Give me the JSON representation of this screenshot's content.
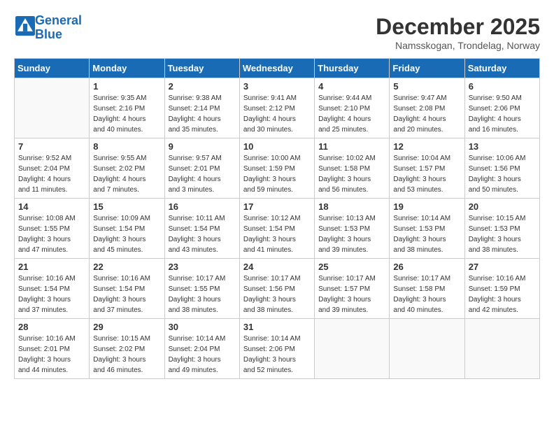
{
  "header": {
    "logo_line1": "General",
    "logo_line2": "Blue",
    "month": "December 2025",
    "location": "Namsskogan, Trondelag, Norway"
  },
  "days_of_week": [
    "Sunday",
    "Monday",
    "Tuesday",
    "Wednesday",
    "Thursday",
    "Friday",
    "Saturday"
  ],
  "weeks": [
    [
      {
        "day": "",
        "info": ""
      },
      {
        "day": "1",
        "info": "Sunrise: 9:35 AM\nSunset: 2:16 PM\nDaylight: 4 hours\nand 40 minutes."
      },
      {
        "day": "2",
        "info": "Sunrise: 9:38 AM\nSunset: 2:14 PM\nDaylight: 4 hours\nand 35 minutes."
      },
      {
        "day": "3",
        "info": "Sunrise: 9:41 AM\nSunset: 2:12 PM\nDaylight: 4 hours\nand 30 minutes."
      },
      {
        "day": "4",
        "info": "Sunrise: 9:44 AM\nSunset: 2:10 PM\nDaylight: 4 hours\nand 25 minutes."
      },
      {
        "day": "5",
        "info": "Sunrise: 9:47 AM\nSunset: 2:08 PM\nDaylight: 4 hours\nand 20 minutes."
      },
      {
        "day": "6",
        "info": "Sunrise: 9:50 AM\nSunset: 2:06 PM\nDaylight: 4 hours\nand 16 minutes."
      }
    ],
    [
      {
        "day": "7",
        "info": "Sunrise: 9:52 AM\nSunset: 2:04 PM\nDaylight: 4 hours\nand 11 minutes."
      },
      {
        "day": "8",
        "info": "Sunrise: 9:55 AM\nSunset: 2:02 PM\nDaylight: 4 hours\nand 7 minutes."
      },
      {
        "day": "9",
        "info": "Sunrise: 9:57 AM\nSunset: 2:01 PM\nDaylight: 4 hours\nand 3 minutes."
      },
      {
        "day": "10",
        "info": "Sunrise: 10:00 AM\nSunset: 1:59 PM\nDaylight: 3 hours\nand 59 minutes."
      },
      {
        "day": "11",
        "info": "Sunrise: 10:02 AM\nSunset: 1:58 PM\nDaylight: 3 hours\nand 56 minutes."
      },
      {
        "day": "12",
        "info": "Sunrise: 10:04 AM\nSunset: 1:57 PM\nDaylight: 3 hours\nand 53 minutes."
      },
      {
        "day": "13",
        "info": "Sunrise: 10:06 AM\nSunset: 1:56 PM\nDaylight: 3 hours\nand 50 minutes."
      }
    ],
    [
      {
        "day": "14",
        "info": "Sunrise: 10:08 AM\nSunset: 1:55 PM\nDaylight: 3 hours\nand 47 minutes."
      },
      {
        "day": "15",
        "info": "Sunrise: 10:09 AM\nSunset: 1:54 PM\nDaylight: 3 hours\nand 45 minutes."
      },
      {
        "day": "16",
        "info": "Sunrise: 10:11 AM\nSunset: 1:54 PM\nDaylight: 3 hours\nand 43 minutes."
      },
      {
        "day": "17",
        "info": "Sunrise: 10:12 AM\nSunset: 1:54 PM\nDaylight: 3 hours\nand 41 minutes."
      },
      {
        "day": "18",
        "info": "Sunrise: 10:13 AM\nSunset: 1:53 PM\nDaylight: 3 hours\nand 39 minutes."
      },
      {
        "day": "19",
        "info": "Sunrise: 10:14 AM\nSunset: 1:53 PM\nDaylight: 3 hours\nand 38 minutes."
      },
      {
        "day": "20",
        "info": "Sunrise: 10:15 AM\nSunset: 1:53 PM\nDaylight: 3 hours\nand 38 minutes."
      }
    ],
    [
      {
        "day": "21",
        "info": "Sunrise: 10:16 AM\nSunset: 1:54 PM\nDaylight: 3 hours\nand 37 minutes."
      },
      {
        "day": "22",
        "info": "Sunrise: 10:16 AM\nSunset: 1:54 PM\nDaylight: 3 hours\nand 37 minutes."
      },
      {
        "day": "23",
        "info": "Sunrise: 10:17 AM\nSunset: 1:55 PM\nDaylight: 3 hours\nand 38 minutes."
      },
      {
        "day": "24",
        "info": "Sunrise: 10:17 AM\nSunset: 1:56 PM\nDaylight: 3 hours\nand 38 minutes."
      },
      {
        "day": "25",
        "info": "Sunrise: 10:17 AM\nSunset: 1:57 PM\nDaylight: 3 hours\nand 39 minutes."
      },
      {
        "day": "26",
        "info": "Sunrise: 10:17 AM\nSunset: 1:58 PM\nDaylight: 3 hours\nand 40 minutes."
      },
      {
        "day": "27",
        "info": "Sunrise: 10:16 AM\nSunset: 1:59 PM\nDaylight: 3 hours\nand 42 minutes."
      }
    ],
    [
      {
        "day": "28",
        "info": "Sunrise: 10:16 AM\nSunset: 2:01 PM\nDaylight: 3 hours\nand 44 minutes."
      },
      {
        "day": "29",
        "info": "Sunrise: 10:15 AM\nSunset: 2:02 PM\nDaylight: 3 hours\nand 46 minutes."
      },
      {
        "day": "30",
        "info": "Sunrise: 10:14 AM\nSunset: 2:04 PM\nDaylight: 3 hours\nand 49 minutes."
      },
      {
        "day": "31",
        "info": "Sunrise: 10:14 AM\nSunset: 2:06 PM\nDaylight: 3 hours\nand 52 minutes."
      },
      {
        "day": "",
        "info": ""
      },
      {
        "day": "",
        "info": ""
      },
      {
        "day": "",
        "info": ""
      }
    ]
  ]
}
